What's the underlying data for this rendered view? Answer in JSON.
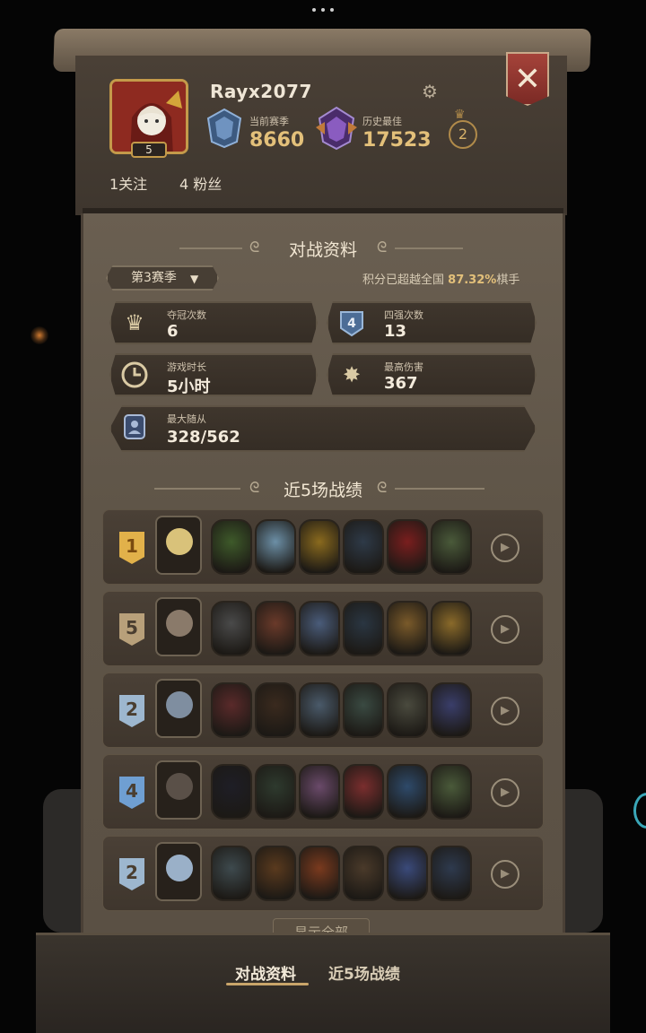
{
  "profile": {
    "username": "Rayx2077",
    "avatar_level": "5",
    "follow": "1关注",
    "fans": "4 粉丝",
    "current_season_label": "当前赛季",
    "current_season_score": "8660",
    "best_label": "历史最佳",
    "best_score": "17523",
    "crown_count": "2"
  },
  "battle_stats": {
    "title": "对战资料",
    "season_select": "第3赛季",
    "rank_note_prefix": "积分已超越全国",
    "rank_note_pct": "87.32%",
    "rank_note_suffix": "棋手",
    "stats": [
      {
        "label": "夺冠次数",
        "value": "6",
        "icon": "crown-icon"
      },
      {
        "label": "四强次数",
        "value": "13",
        "icon": "top4-icon"
      },
      {
        "label": "游戏时长",
        "value": "5小时",
        "icon": "clock-icon"
      },
      {
        "label": "最高伤害",
        "value": "367",
        "icon": "damage-icon"
      },
      {
        "label": "最大随从",
        "value": "328/562",
        "icon": "minion-icon"
      }
    ]
  },
  "recent": {
    "title": "近5场战绩",
    "matches": [
      {
        "place": "1",
        "badge_color": "#e2b14a"
      },
      {
        "place": "5",
        "badge_color": "#b8a07a"
      },
      {
        "place": "2",
        "badge_color": "#9db7cf"
      },
      {
        "place": "4",
        "badge_color": "#6f9fd2"
      },
      {
        "place": "2",
        "badge_color": "#9db7cf"
      }
    ],
    "show_all": "显示全部"
  },
  "tabs": {
    "active": "对战资料",
    "other": "近5场战绩"
  },
  "colors": {
    "gold": "#e3c07a",
    "parchment": "#5f5548",
    "close_red": "#a5433a"
  }
}
